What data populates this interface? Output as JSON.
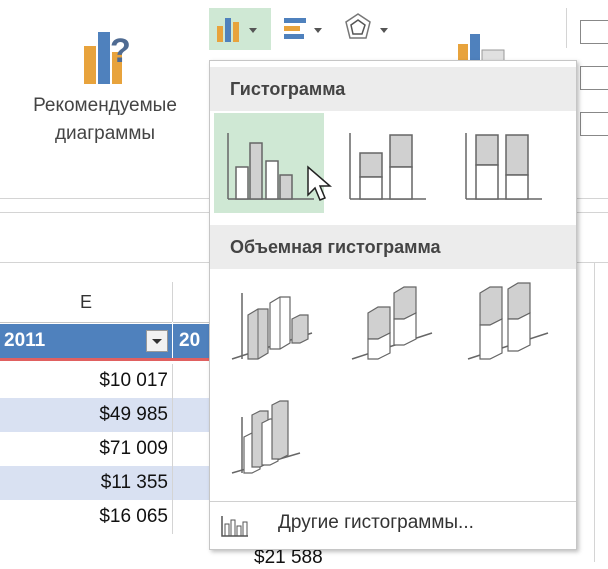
{
  "ribbon": {
    "recommended_line1": "Рекомендуемые",
    "recommended_line2": "диаграммы"
  },
  "sheet": {
    "column_header": "E",
    "table_header_col": "2011",
    "table_header_next": "20",
    "rows": [
      "$10 017",
      "$49 985",
      "$71 009",
      "$11 355",
      "$16 065"
    ],
    "partial_cell": "$21 588"
  },
  "dropdown": {
    "section1_title": "Гистограмма",
    "section2_title": "Объемная гистограмма",
    "more_label": "Другие гистограммы..."
  },
  "colors": {
    "table_header": "#4f81bd",
    "row_band": "#d9e1f2",
    "selected_tile": "#cfe8d4",
    "bar_fill": "#d0d0d0"
  }
}
